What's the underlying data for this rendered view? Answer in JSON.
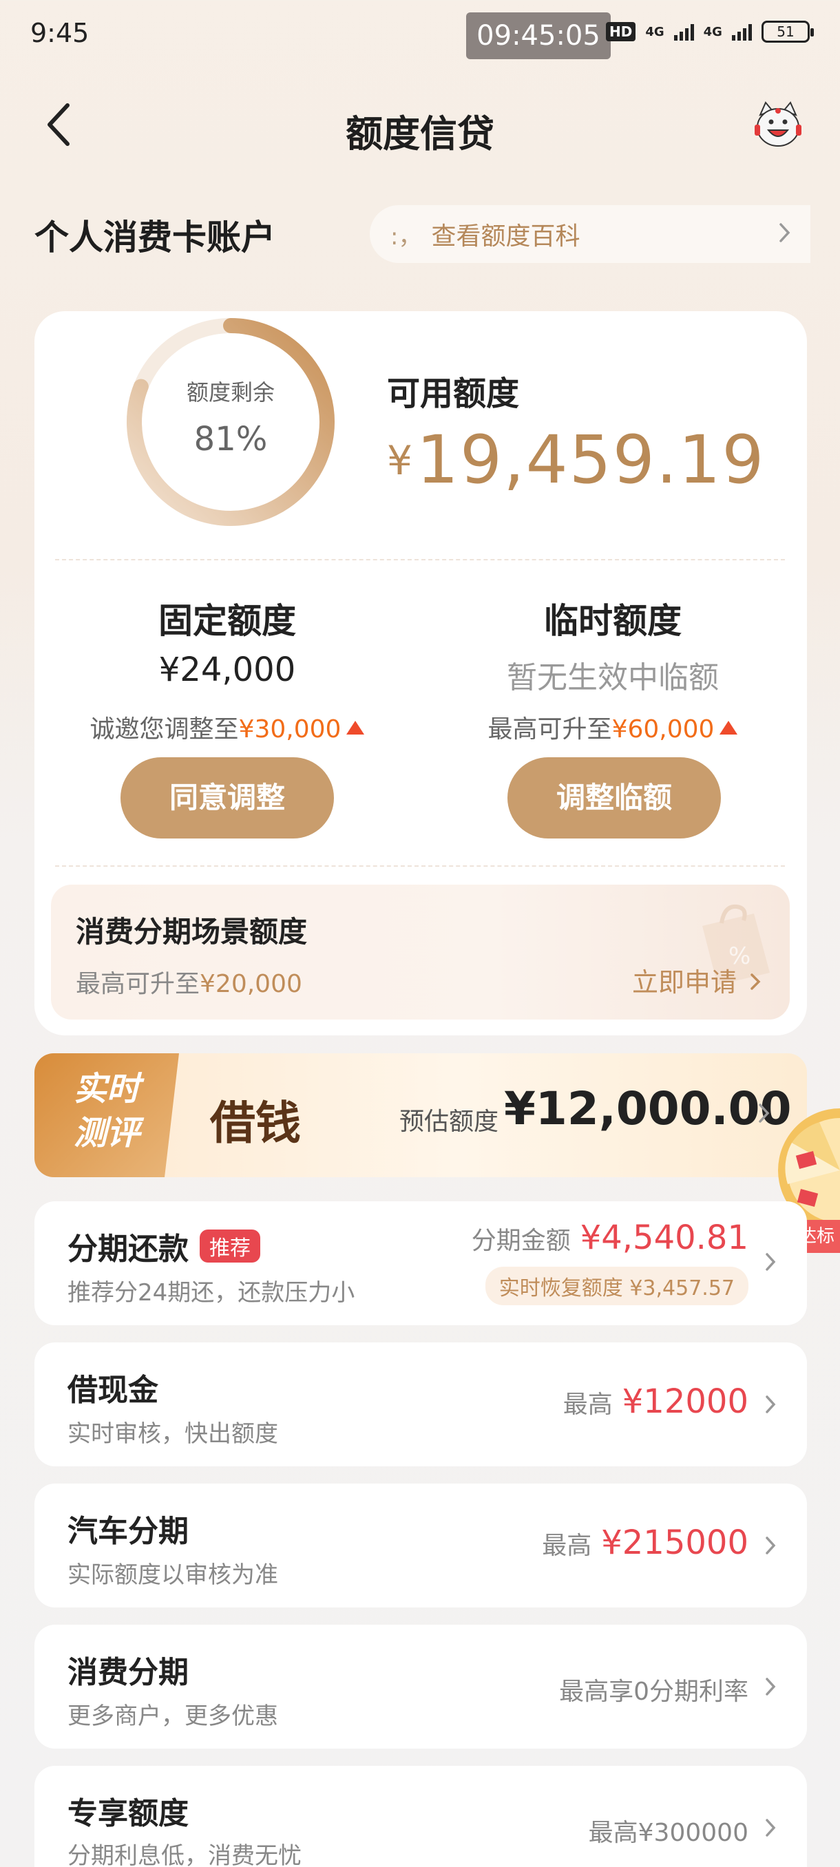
{
  "status_bar": {
    "time": "9:45",
    "overlay_time": "09:45:05",
    "hd": "HD",
    "net1": "4G",
    "net2": "4G",
    "battery": "51"
  },
  "header": {
    "title": "额度信贷"
  },
  "account": {
    "title": "个人消费卡账户",
    "link_dots": ":，",
    "link_text": "查看额度百科"
  },
  "summary": {
    "gauge_label": "额度剩余",
    "gauge_value": "81%",
    "gauge_fraction": 0.81,
    "available_label": "可用额度",
    "currency": "¥",
    "available_amount": "19,459.19"
  },
  "fixed": {
    "title": "固定额度",
    "amount": "¥24,000",
    "note_prefix": "诚邀您调整至",
    "note_value": "¥30,000",
    "button": "同意调整"
  },
  "temporary": {
    "title": "临时额度",
    "status": "暂无生效中临额",
    "note_prefix": "最高可升至",
    "note_value": "¥60,000",
    "button": "调整临额"
  },
  "scene": {
    "title": "消费分期场景额度",
    "sub_prefix": "最高可升至",
    "sub_value": "¥20,000",
    "apply": "立即申请"
  },
  "banner": {
    "badge_line1": "实时",
    "badge_line2": "测评",
    "title": "借钱",
    "est_label": "预估额度",
    "est_value": "¥12,000.00",
    "target_tag": "达标"
  },
  "items": [
    {
      "title": "分期还款",
      "badge": "推荐",
      "sub": "推荐分24期还，还款压力小",
      "right_label": "分期金额",
      "right_value": "¥4,540.81",
      "tag": "实时恢复额度 ¥3,457.57"
    },
    {
      "title": "借现金",
      "sub": "实时审核，快出额度",
      "right_label": "最高",
      "right_value": "¥12000"
    },
    {
      "title": "汽车分期",
      "sub": "实际额度以审核为准",
      "right_label": "最高",
      "right_value": "¥215000"
    },
    {
      "title": "消费分期",
      "sub": "更多商户，更多优惠",
      "right_text": "最高享0分期利率"
    },
    {
      "title": "专享额度",
      "sub": "分期利息低，消费无忧",
      "right_text": "最高¥300000"
    }
  ],
  "colors": {
    "accent_gold": "#c99d6d",
    "amount_gold": "#b98a57",
    "highlight_orange": "#f26c18",
    "red": "#e8474f"
  }
}
